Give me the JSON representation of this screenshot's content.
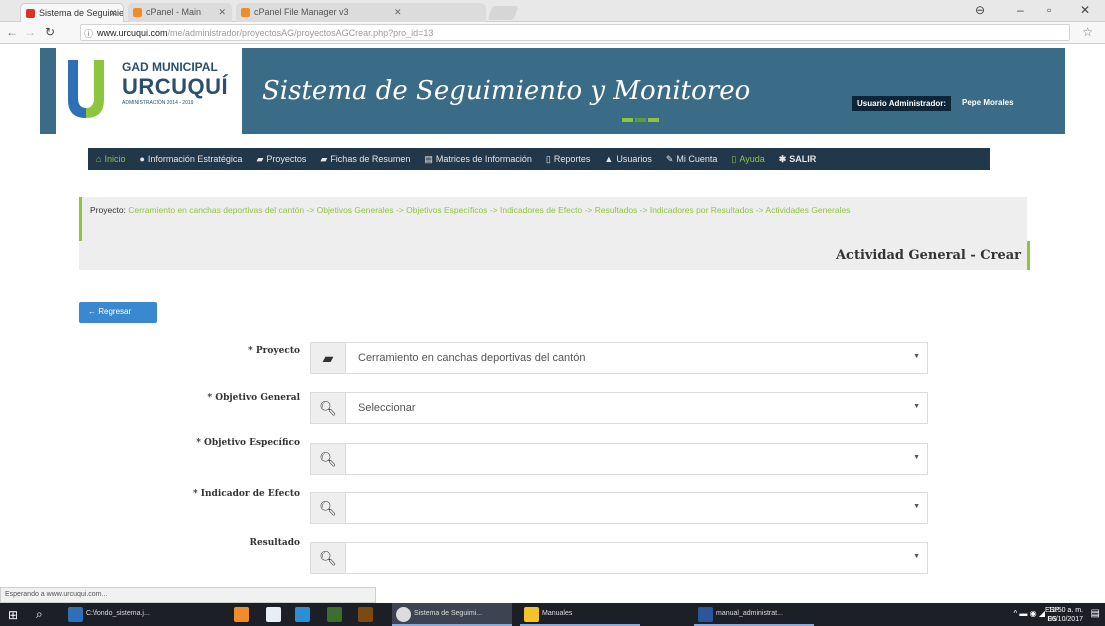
{
  "browser": {
    "tabs": [
      {
        "title": "Sistema de Seguimient",
        "favicon_color": "#d9342b",
        "active": true
      },
      {
        "title": "cPanel - Main",
        "favicon_color": "#f08c2e",
        "active": false
      },
      {
        "title": "cPanel File Manager v3",
        "favicon_color": "#f08c2e",
        "active": false
      }
    ],
    "url_host": "www.urcuqui.com",
    "url_path": "/me/administrador/proyectosAG/proyectosAGCrear.php?pro_id=13",
    "status_text": "Esperando a www.urcuqui.com..."
  },
  "header": {
    "logo_line1": "GAD MUNICIPAL",
    "logo_line2": "URCUQUÍ",
    "logo_line3": "ADMINISTRACIÓN 2014 - 2019",
    "title": "Sistema de Seguimiento y Monitoreo",
    "user_role": "Usuario Administrador:",
    "user_name": "Pepe Morales"
  },
  "nav": [
    {
      "label": "Inicio",
      "icon": "home-icon",
      "glyph": "⌂"
    },
    {
      "label": "Información Estratégica",
      "icon": "info-icon",
      "glyph": "●"
    },
    {
      "label": "Proyectos",
      "icon": "book-icon",
      "glyph": "▰"
    },
    {
      "label": "Fichas de Resumen",
      "icon": "book-icon",
      "glyph": "▰"
    },
    {
      "label": "Matrices de Información",
      "icon": "table-icon",
      "glyph": "▤"
    },
    {
      "label": "Reportes",
      "icon": "file-icon",
      "glyph": "▯"
    },
    {
      "label": "Usuarios",
      "icon": "user-icon",
      "glyph": "▲"
    },
    {
      "label": "Mi Cuenta",
      "icon": "pencil-icon",
      "glyph": "✎"
    },
    {
      "label": "Ayuda",
      "icon": "help-icon",
      "glyph": "▯"
    },
    {
      "label": "SALIR",
      "icon": "gear-icon",
      "glyph": "✱"
    }
  ],
  "breadcrumb": {
    "label": "Proyecto:",
    "items": [
      "Cerramiento en canchas deportivas del cantón",
      "Objetivos Generales",
      "Objetivos Específicos",
      "Indicadores de Efecto",
      "Resultados",
      "Indicadores por Resultados",
      "Actividades Generales"
    ],
    "separator": "->"
  },
  "page_title": "Actividad General - Crear",
  "back_button": "Regresar",
  "form": {
    "fields": [
      {
        "label": "* Proyecto",
        "icon": "book-icon",
        "value": "Cerramiento en canchas deportivas del cantón"
      },
      {
        "label": "* Objetivo General",
        "icon": "search-icon",
        "value": "Seleccionar"
      },
      {
        "label": "* Objetivo Específico",
        "icon": "search-icon",
        "value": ""
      },
      {
        "label": "* Indicador de Efecto",
        "icon": "search-icon",
        "value": ""
      },
      {
        "label": "Resultado",
        "icon": "search-icon",
        "value": ""
      }
    ]
  },
  "taskbar": {
    "items": [
      {
        "label": "C:\\fondo_sistema.j...",
        "color": "#2f6fb5"
      },
      {
        "label": "Sistema de Seguimi...",
        "color": "#dcdcdc"
      },
      {
        "label": "Manuales",
        "color": "#f2c32d"
      },
      {
        "label": "manual_administrat...",
        "color": "#2b579a"
      }
    ],
    "lang_top": "ESP",
    "lang_bottom": "ES",
    "time": "11:50 a. m.",
    "date": "06/10/2017"
  }
}
